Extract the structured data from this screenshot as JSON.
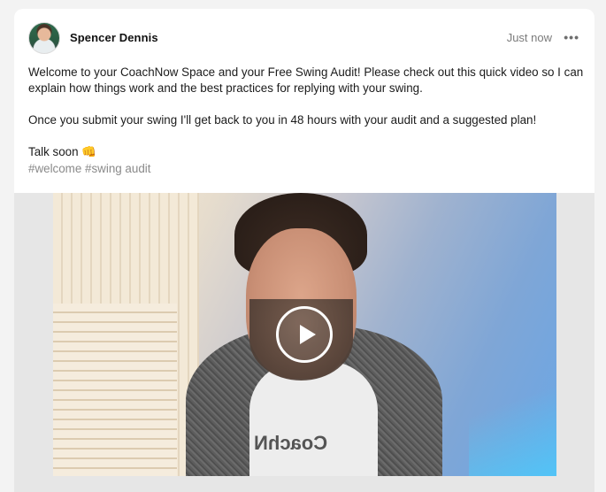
{
  "post": {
    "author": "Spencer Dennis",
    "timestamp": "Just now",
    "more_icon": "•••",
    "paragraphs": [
      "Welcome to your CoachNow Space and your Free Swing Audit! Please check out this quick video so I can explain how things work and the best practices for replying with your swing.",
      "Once you submit your swing I'll get back to you in 48 hours with your audit and a suggested plan!",
      "Talk soon 👊"
    ],
    "tags": [
      "#welcome",
      "#swing audit"
    ]
  },
  "video": {
    "shirt_text": "CoachN"
  },
  "colors": {
    "card_bg": "#ffffff",
    "page_bg": "#f3f3f3",
    "tag_color": "#8a8a8a",
    "timestamp_color": "#7b7b7b"
  },
  "icons": {
    "avatar": "user-avatar",
    "more": "more-horizontal-icon",
    "play": "play-icon"
  }
}
